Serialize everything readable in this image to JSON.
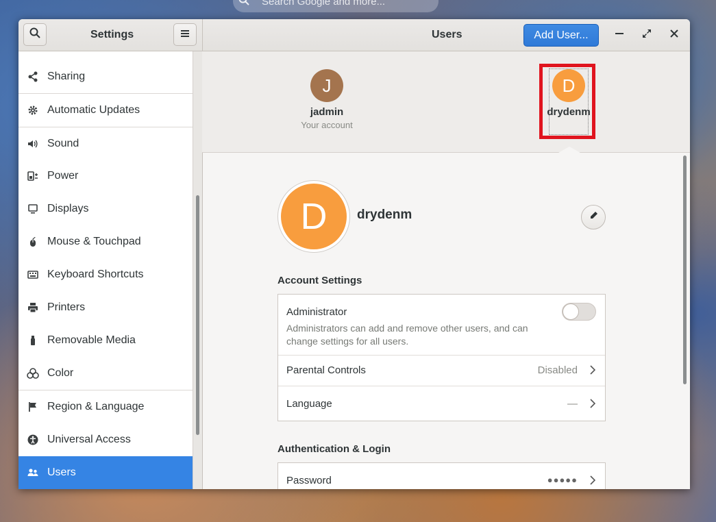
{
  "desktop": {
    "search_placeholder": "Search Google and more..."
  },
  "headerbar": {
    "settings_title": "Settings",
    "users_title": "Users",
    "add_user_label": "Add User..."
  },
  "sidebar": {
    "items": [
      {
        "label": "Sharing",
        "icon": "share-icon"
      },
      {
        "label": "Automatic Updates",
        "icon": "gear-icon"
      },
      {
        "label": "Sound",
        "icon": "speaker-icon"
      },
      {
        "label": "Power",
        "icon": "power-icon"
      },
      {
        "label": "Displays",
        "icon": "display-icon"
      },
      {
        "label": "Mouse & Touchpad",
        "icon": "mouse-icon"
      },
      {
        "label": "Keyboard Shortcuts",
        "icon": "keyboard-icon"
      },
      {
        "label": "Printers",
        "icon": "printer-icon"
      },
      {
        "label": "Removable Media",
        "icon": "usb-icon"
      },
      {
        "label": "Color",
        "icon": "color-icon"
      },
      {
        "label": "Region & Language",
        "icon": "flag-icon"
      },
      {
        "label": "Universal Access",
        "icon": "accessibility-icon"
      },
      {
        "label": "Users",
        "icon": "users-icon"
      }
    ],
    "active": "Users"
  },
  "users": [
    {
      "initial": "J",
      "name": "jadmin",
      "subtitle": "Your account",
      "color": "#a4744e"
    },
    {
      "initial": "D",
      "name": "drydenm",
      "subtitle": "",
      "color": "#f89d3e"
    }
  ],
  "selected_user": {
    "initial": "D",
    "name": "drydenm"
  },
  "account_settings": {
    "title": "Account Settings",
    "administrator_label": "Administrator",
    "administrator_desc_1": "Administrators can add and remove other users, and can",
    "administrator_desc_2": "change settings for all users.",
    "administrator_enabled": false,
    "parental_label": "Parental Controls",
    "parental_value": "Disabled",
    "language_label": "Language",
    "language_value": "—"
  },
  "auth": {
    "title": "Authentication & Login",
    "password_label": "Password",
    "password_value": "●●●●●"
  },
  "colors": {
    "accent": "#3584e4",
    "highlight_box": "#e0141e"
  }
}
